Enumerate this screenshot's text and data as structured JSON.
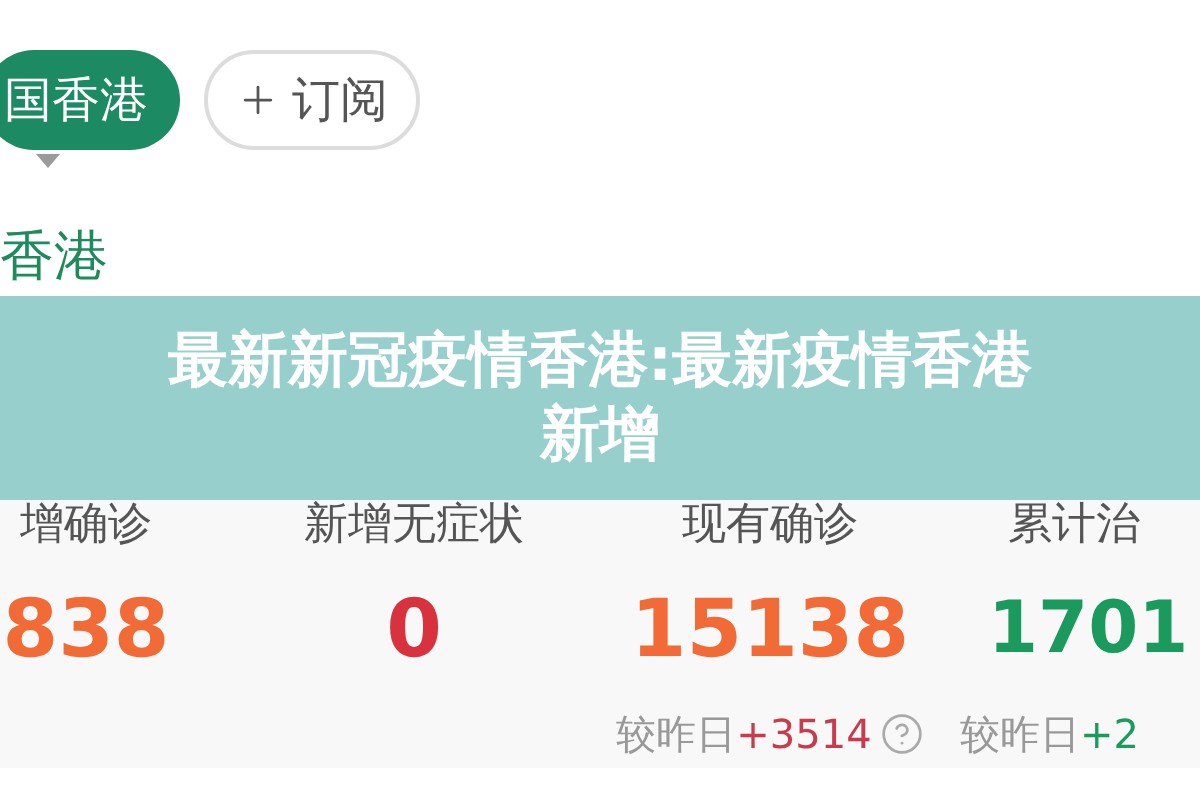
{
  "region_tab": {
    "label": "国香港",
    "selected": true
  },
  "subscribe_button": {
    "label": "订阅"
  },
  "section_title": "香港",
  "title_banner": {
    "lines": [
      "最新新冠疫情香港:最新疫情香港",
      "新增"
    ]
  },
  "stats": [
    {
      "label": "增确诊",
      "value": "838",
      "color": "#f26a36"
    },
    {
      "label": "新增无症状",
      "value": "0",
      "color": "#d9323f"
    },
    {
      "label": "现有确诊",
      "value": "15138",
      "color": "#f26a36",
      "change_label": "较昨日",
      "change": {
        "text": "+3514",
        "color": "#c83a4c"
      },
      "help": true
    },
    {
      "label": "累计治",
      "value": "1701",
      "color": "#1a9a5c",
      "change_label": "较昨日",
      "change": {
        "text": "+2",
        "color": "#1a9a5c"
      },
      "help": false
    }
  ]
}
